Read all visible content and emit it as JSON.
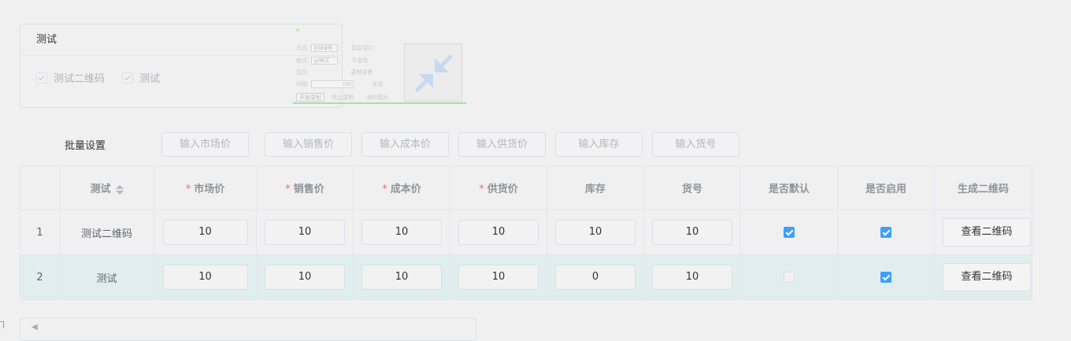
{
  "spec_card": {
    "title": "测试",
    "options": [
      "测试二维码",
      "测试"
    ]
  },
  "capture_tool": {
    "mode_label": "方式:",
    "mode_value": "区域录制",
    "format_label": "格式:",
    "format_value": "gif格式",
    "fixed_window": "固定窗口",
    "color_value": "不变色",
    "display_label": "显示:",
    "record_bg": "录制背景",
    "interval_label": "间隔:",
    "interval_value": "100",
    "close_label": "关闭",
    "start_btn": "开始录制",
    "stop_btn": "停止录制",
    "save_btn": "保存图片",
    "accent": "#a8e0a8"
  },
  "batch": {
    "label": "批量设置",
    "buttons": [
      "输入市场价",
      "输入销售价",
      "输入成本价",
      "输入供货价",
      "输入库存",
      "输入货号"
    ]
  },
  "table": {
    "headers": {
      "spec": "测试",
      "market_price": "市场价",
      "sale_price": "销售价",
      "cost_price": "成本价",
      "supply_price": "供货价",
      "stock": "库存",
      "sku_no": "货号",
      "is_default": "是否默认",
      "is_enabled": "是否启用",
      "qr": "生成二维码"
    },
    "required_mark": "*",
    "rows": [
      {
        "index": "1",
        "spec": "测试二维码",
        "market_price": "10",
        "sale_price": "10",
        "cost_price": "10",
        "supply_price": "10",
        "stock": "10",
        "sku_no": "10",
        "is_default": true,
        "is_enabled": true,
        "qr_button": "查看二维码"
      },
      {
        "index": "2",
        "spec": "测试",
        "market_price": "10",
        "sale_price": "10",
        "cost_price": "10",
        "supply_price": "10",
        "stock": "0",
        "sku_no": "10",
        "is_default": false,
        "is_enabled": true,
        "qr_button": "查看二维码"
      }
    ]
  },
  "colors": {
    "checkbox_on": "#409eff",
    "required": "#f56c6c",
    "row_highlight": "#e1eeef"
  }
}
